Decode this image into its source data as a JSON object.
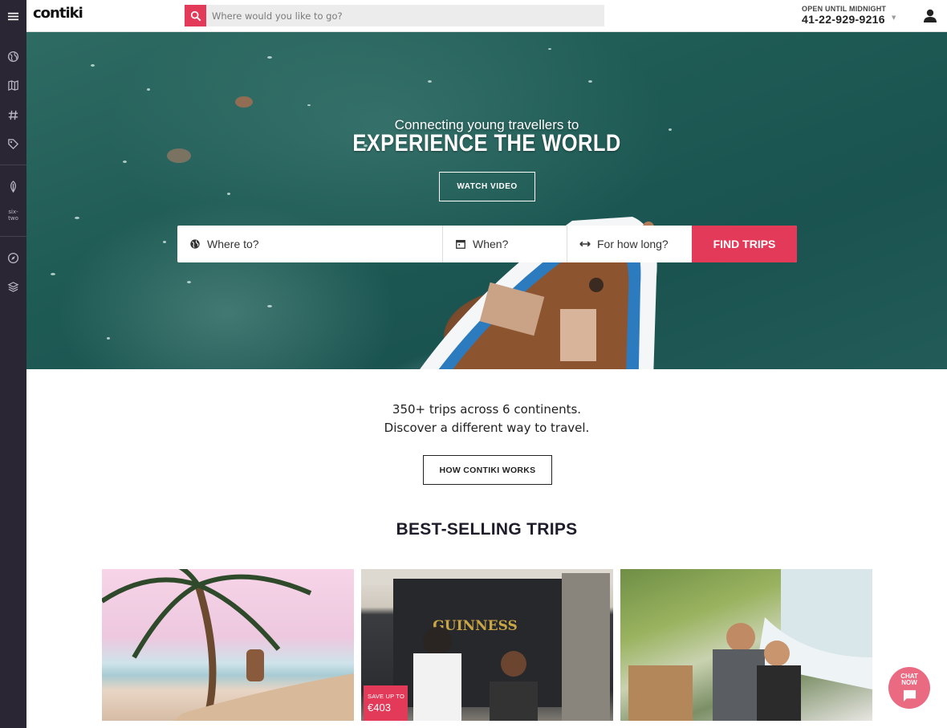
{
  "brand": {
    "logo": "contiki",
    "accent": "#e43a59",
    "sidebar_bg": "#2a2634"
  },
  "header": {
    "search_placeholder": "Where would you like to go?",
    "hours_label": "OPEN UNTIL MIDNIGHT",
    "phone": "41-22-929-9216"
  },
  "sidebar": {
    "items": [
      {
        "icon": "menu-icon"
      },
      {
        "icon": "globe-icon"
      },
      {
        "icon": "map-icon"
      },
      {
        "icon": "hashtag-icon"
      },
      {
        "icon": "tag-icon"
      },
      {
        "icon": "leaf-icon"
      },
      {
        "icon": "sixtwo-icon",
        "label": "six-\ntwo"
      },
      {
        "icon": "compass-icon"
      },
      {
        "icon": "layers-icon"
      }
    ]
  },
  "hero": {
    "subtitle": "Connecting young travellers to",
    "title": "EXPERIENCE THE WORLD",
    "watch_video": "WATCH VIDEO",
    "where": "Where to?",
    "when": "When?",
    "how_long": "For how long?",
    "find_trips": "FIND TRIPS"
  },
  "intro": {
    "line1": "350+ trips across 6 continents.",
    "line2": "Discover a different way to travel.",
    "how_button": "HOW CONTIKI WORKS"
  },
  "best_selling": {
    "title": "BEST-SELLING TRIPS",
    "cards": [
      {
        "badge": null
      },
      {
        "badge_label": "SAVE UP TO",
        "badge_price": "€403",
        "sign": "GUINNESS"
      },
      {
        "badge": null
      }
    ]
  },
  "chat": {
    "label_line1": "CHAT",
    "label_line2": "NOW"
  }
}
